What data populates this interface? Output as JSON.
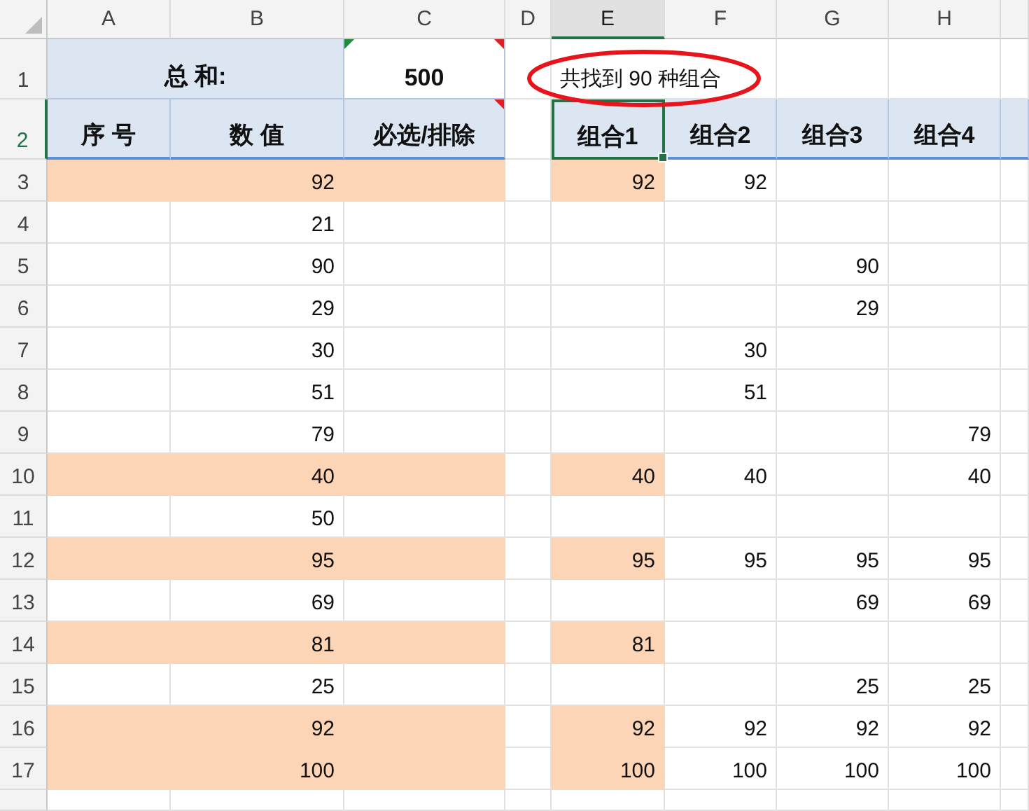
{
  "column_headers": [
    {
      "label": "A",
      "selected": false
    },
    {
      "label": "B",
      "selected": false
    },
    {
      "label": "C",
      "selected": false
    },
    {
      "label": "D",
      "selected": false
    },
    {
      "label": "E",
      "selected": true
    },
    {
      "label": "F",
      "selected": false
    },
    {
      "label": "G",
      "selected": false
    },
    {
      "label": "H",
      "selected": false
    }
  ],
  "summary": {
    "row_number": "1",
    "label": "总 和:",
    "total": "500",
    "total_note": true,
    "total_warning": true,
    "result": "共找到 90 种组合",
    "circled": true
  },
  "header_row": {
    "row_number": "2",
    "selected": true,
    "columns": [
      {
        "label": "序 号",
        "note": false
      },
      {
        "label": "数 值",
        "note": false
      },
      {
        "label": "必选/排除",
        "note": true
      }
    ],
    "combos": [
      {
        "label": "组合1",
        "selected": true
      },
      {
        "label": "组合2",
        "selected": false
      },
      {
        "label": "组合3",
        "selected": false
      },
      {
        "label": "组合4",
        "selected": false
      }
    ]
  },
  "rows": [
    {
      "row_number": "3",
      "value": "92",
      "highlighted": true,
      "combos": {
        "combo_1": "92",
        "combo_2": "92"
      }
    },
    {
      "row_number": "4",
      "value": "21",
      "highlighted": false,
      "combos": {}
    },
    {
      "row_number": "5",
      "value": "90",
      "highlighted": false,
      "combos": {
        "combo_3": "90"
      }
    },
    {
      "row_number": "6",
      "value": "29",
      "highlighted": false,
      "combos": {
        "combo_3": "29"
      }
    },
    {
      "row_number": "7",
      "value": "30",
      "highlighted": false,
      "combos": {
        "combo_2": "30"
      }
    },
    {
      "row_number": "8",
      "value": "51",
      "highlighted": false,
      "combos": {
        "combo_2": "51"
      }
    },
    {
      "row_number": "9",
      "value": "79",
      "highlighted": false,
      "combos": {
        "combo_4": "79"
      }
    },
    {
      "row_number": "10",
      "value": "40",
      "highlighted": true,
      "combos": {
        "combo_1": "40",
        "combo_2": "40",
        "combo_4": "40"
      }
    },
    {
      "row_number": "11",
      "value": "50",
      "highlighted": false,
      "combos": {}
    },
    {
      "row_number": "12",
      "value": "95",
      "highlighted": true,
      "combos": {
        "combo_1": "95",
        "combo_2": "95",
        "combo_3": "95",
        "combo_4": "95"
      }
    },
    {
      "row_number": "13",
      "value": "69",
      "highlighted": false,
      "combos": {
        "combo_3": "69",
        "combo_4": "69"
      }
    },
    {
      "row_number": "14",
      "value": "81",
      "highlighted": true,
      "combos": {
        "combo_1": "81"
      }
    },
    {
      "row_number": "15",
      "value": "25",
      "highlighted": false,
      "combos": {
        "combo_3": "25",
        "combo_4": "25"
      }
    },
    {
      "row_number": "16",
      "value": "92",
      "highlighted": true,
      "combos": {
        "combo_1": "92",
        "combo_2": "92",
        "combo_3": "92",
        "combo_4": "92"
      }
    },
    {
      "row_number": "17",
      "value": "100",
      "highlighted": true,
      "combos": {
        "combo_1": "100",
        "combo_2": "100",
        "combo_3": "100",
        "combo_4": "100"
      }
    }
  ]
}
